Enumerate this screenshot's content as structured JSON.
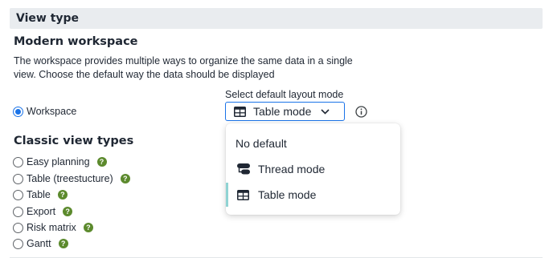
{
  "section": {
    "title": "View type"
  },
  "modern": {
    "heading": "Modern workspace",
    "description": "The workspace provides multiple ways to organize the same data in a single view. Choose the default way the data should be displayed",
    "workspace_label": "Workspace",
    "workspace_checked": true
  },
  "layout_select": {
    "label": "Select default layout mode",
    "value": "Table mode",
    "options": [
      {
        "label": "No default",
        "icon": ""
      },
      {
        "label": "Thread mode",
        "icon": "thread-icon"
      },
      {
        "label": "Table mode",
        "icon": "table-icon",
        "selected": true
      }
    ]
  },
  "classic": {
    "heading": "Classic view types",
    "items": [
      {
        "label": "Easy planning",
        "help": "?"
      },
      {
        "label": "Table (treestucture)",
        "help": "?"
      },
      {
        "label": "Table",
        "help": "?"
      },
      {
        "label": "Export",
        "help": "?"
      },
      {
        "label": "Risk matrix",
        "help": "?"
      },
      {
        "label": "Gantt",
        "help": "?"
      }
    ]
  },
  "colors": {
    "accent": "#1a73e8",
    "help_badge": "#5c8a2d",
    "selected_bar": "#8fd3d3",
    "header_bg": "#e9ecef"
  }
}
